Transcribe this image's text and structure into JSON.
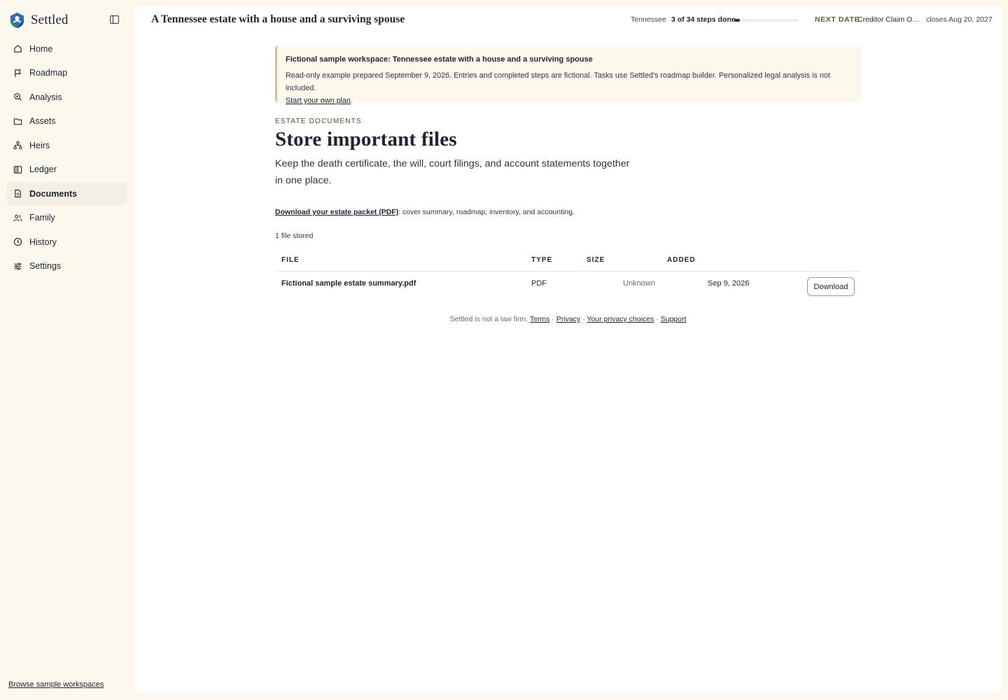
{
  "brand": {
    "name": "Settled"
  },
  "sidebar": {
    "items": [
      {
        "label": "Home",
        "icon": "home-icon"
      },
      {
        "label": "Roadmap",
        "icon": "flag-icon"
      },
      {
        "label": "Analysis",
        "icon": "magnifier-icon"
      },
      {
        "label": "Assets",
        "icon": "folder-icon"
      },
      {
        "label": "Heirs",
        "icon": "org-chart-icon"
      },
      {
        "label": "Ledger",
        "icon": "columns-icon"
      },
      {
        "label": "Documents",
        "icon": "document-icon",
        "active": true
      },
      {
        "label": "Family",
        "icon": "people-icon"
      },
      {
        "label": "History",
        "icon": "clock-icon"
      },
      {
        "label": "Settings",
        "icon": "sliders-icon"
      }
    ],
    "browse_link": "Browse sample workspaces"
  },
  "topbar": {
    "title": "A Tennessee estate with a house and a surviving spouse",
    "state": "Tennessee",
    "steps": "3 of 34 steps done",
    "progress": {
      "done": 3,
      "total": 34
    },
    "next_label": "NEXT DATE",
    "next_event": "Creditor Claim Out…",
    "next_date": "closes Aug 20, 2027"
  },
  "notice": {
    "title": "Fictional sample workspace: Tennessee estate with a house and a surviving spouse",
    "body": "Read-only example prepared September 9, 2026. Entries and completed steps are fictional. Tasks use Settled's roadmap builder. Personalized legal analysis is not included.",
    "link": "Start your own plan",
    "link_suffix": "."
  },
  "page": {
    "eyebrow": "ESTATE DOCUMENTS",
    "title": "Store important files",
    "subtitle": "Keep the death certificate, the will, court filings, and account statements together in one place.",
    "packet_link": "Download your estate packet (PDF)",
    "packet_suffix": ": cover summary, roadmap, inventory, and accounting.",
    "file_count": "1 file stored"
  },
  "table": {
    "headers": {
      "file": "FILE",
      "type": "TYPE",
      "size": "SIZE",
      "added": "ADDED"
    },
    "rows": [
      {
        "file": "Fictional sample estate summary.pdf",
        "type": "PDF",
        "size": "Unknown",
        "added": "Sep 9, 2026",
        "action": "Download"
      }
    ]
  },
  "footer": {
    "text": "Settled is not a law firm.",
    "links": [
      "Terms",
      "Privacy",
      "Your privacy choices",
      "Support"
    ],
    "separator": " · "
  },
  "colors": {
    "accent": "#1f3050",
    "notice_border": "#d6c28c",
    "background": "#fcf8ee"
  }
}
